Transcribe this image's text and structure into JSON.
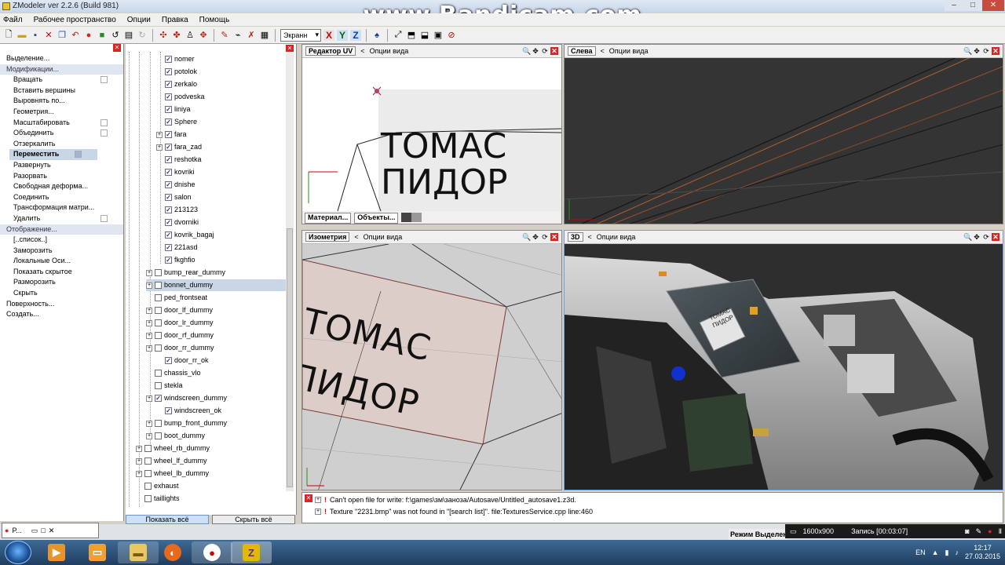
{
  "window": {
    "title": "ZModeler ver 2.2.6 (Build 981)"
  },
  "watermark": "www.Bandicam.com",
  "menu": [
    "Файл",
    "Рабочее пространство",
    "Опции",
    "Правка",
    "Помощь"
  ],
  "toolbar": {
    "view_select": "Экранн",
    "axes": [
      "X",
      "Y",
      "Z"
    ]
  },
  "left_panel": {
    "items": [
      {
        "label": "Выделение...",
        "kind": "sec"
      },
      {
        "label": "Модификации...",
        "kind": "hdr"
      },
      {
        "label": "Вращать",
        "kind": "sub"
      },
      {
        "label": "Вставить вершины",
        "kind": "sub"
      },
      {
        "label": "Выровнять по...",
        "kind": "sub"
      },
      {
        "label": "Геометрия...",
        "kind": "sub"
      },
      {
        "label": "Масштабировать",
        "kind": "sub"
      },
      {
        "label": "Объединить",
        "kind": "sub"
      },
      {
        "label": "Отзеркалить",
        "kind": "sub"
      },
      {
        "label": "Переместить",
        "kind": "sel"
      },
      {
        "label": "Развернуть",
        "kind": "sub"
      },
      {
        "label": "Разорвать",
        "kind": "sub"
      },
      {
        "label": "Свободная деформа...",
        "kind": "sub"
      },
      {
        "label": "Соединить",
        "kind": "sub"
      },
      {
        "label": "Трансформация матри...",
        "kind": "sub"
      },
      {
        "label": "Удалить",
        "kind": "sub"
      },
      {
        "label": "Отображение...",
        "kind": "hdr"
      },
      {
        "label": "[..список..]",
        "kind": "sub"
      },
      {
        "label": "Заморозить",
        "kind": "sub"
      },
      {
        "label": "Локальные Оси...",
        "kind": "sub"
      },
      {
        "label": "Показать скрытое",
        "kind": "sub"
      },
      {
        "label": "Разморозить",
        "kind": "sub"
      },
      {
        "label": "Скрыть",
        "kind": "sub"
      },
      {
        "label": "Поверхность...",
        "kind": "sec"
      },
      {
        "label": "Создать...",
        "kind": "sec"
      }
    ]
  },
  "tree": {
    "rows": [
      {
        "label": "nomer",
        "level": 3,
        "checked": true,
        "expand": false
      },
      {
        "label": "potolok",
        "level": 3,
        "checked": true,
        "expand": false
      },
      {
        "label": "zerkalo",
        "level": 3,
        "checked": true,
        "expand": false
      },
      {
        "label": "podveska",
        "level": 3,
        "checked": true,
        "expand": false
      },
      {
        "label": "liniya",
        "level": 3,
        "checked": true,
        "expand": false
      },
      {
        "label": "Sphere",
        "level": 3,
        "checked": true,
        "expand": false
      },
      {
        "label": "fara",
        "level": 3,
        "checked": true,
        "expand": true
      },
      {
        "label": "fara_zad",
        "level": 3,
        "checked": true,
        "expand": true
      },
      {
        "label": "reshotka",
        "level": 3,
        "checked": true,
        "expand": false
      },
      {
        "label": "kovriki",
        "level": 3,
        "checked": true,
        "expand": false
      },
      {
        "label": "dnishe",
        "level": 3,
        "checked": true,
        "expand": false
      },
      {
        "label": "salon",
        "level": 3,
        "checked": true,
        "expand": false
      },
      {
        "label": "213123",
        "level": 3,
        "checked": true,
        "expand": false
      },
      {
        "label": "dvorniki",
        "level": 3,
        "checked": true,
        "expand": false
      },
      {
        "label": "kovrik_bagaj",
        "level": 3,
        "checked": true,
        "expand": false
      },
      {
        "label": "221asd",
        "level": 3,
        "checked": true,
        "expand": false
      },
      {
        "label": "fkghfio",
        "level": 3,
        "checked": true,
        "expand": false
      },
      {
        "label": "bump_rear_dummy",
        "level": 2,
        "checked": false,
        "expand": true
      },
      {
        "label": "bonnet_dummy",
        "level": 2,
        "checked": false,
        "expand": true,
        "selected": true
      },
      {
        "label": "ped_frontseat",
        "level": 2,
        "checked": false,
        "expand": false
      },
      {
        "label": "door_lf_dummy",
        "level": 2,
        "checked": false,
        "expand": true
      },
      {
        "label": "door_lr_dummy",
        "level": 2,
        "checked": false,
        "expand": true
      },
      {
        "label": "door_rf_dummy",
        "level": 2,
        "checked": false,
        "expand": true
      },
      {
        "label": "door_rr_dummy",
        "level": 2,
        "checked": false,
        "expand": true
      },
      {
        "label": "door_rr_ok",
        "level": 3,
        "checked": true,
        "expand": false
      },
      {
        "label": "chassis_vlo",
        "level": 2,
        "checked": false,
        "expand": false
      },
      {
        "label": "stekla",
        "level": 2,
        "checked": false,
        "expand": false
      },
      {
        "label": "windscreen_dummy",
        "level": 2,
        "checked": true,
        "expand": true
      },
      {
        "label": "windscreen_ok",
        "level": 3,
        "checked": true,
        "expand": false
      },
      {
        "label": "bump_front_dummy",
        "level": 2,
        "checked": false,
        "expand": true
      },
      {
        "label": "boot_dummy",
        "level": 2,
        "checked": false,
        "expand": true
      },
      {
        "label": "wheel_rb_dummy",
        "level": 1,
        "checked": false,
        "expand": true
      },
      {
        "label": "wheel_lf_dummy",
        "level": 1,
        "checked": false,
        "expand": true
      },
      {
        "label": "wheel_lb_dummy",
        "level": 1,
        "checked": false,
        "expand": true
      },
      {
        "label": "exhaust",
        "level": 1,
        "checked": false,
        "expand": false
      },
      {
        "label": "taillights",
        "level": 1,
        "checked": false,
        "expand": false
      }
    ],
    "show_all": "Показать всё",
    "hide_all": "Скрыть всё"
  },
  "viewports": {
    "uv": {
      "label": "Редактор UV",
      "options": "Опции вида",
      "tab_materials": "Материал...",
      "tab_objects": "Объекты..."
    },
    "left": {
      "label": "Слева",
      "options": "Опции вида"
    },
    "iso": {
      "label": "Изометрия",
      "options": "Опции вида"
    },
    "persp": {
      "label": "3D",
      "options": "Опции вида"
    },
    "decal_line1": "ТОМАС",
    "decal_line2": "ПИДОР",
    "car_decal_line1": "ТОМАС",
    "car_decal_line2": "ПИДОР"
  },
  "console": [
    "Can't open file for write: f:\\games\\зм\\заноза/Autosave/Untitled_autosave1.z3d.",
    "Texture \"2231.bmp\" was not found in \"[search list]\". file:TexturesService.cpp line:460"
  ],
  "statusbar": {
    "mode": "Режим Выделения"
  },
  "mini_window": {
    "label": "P..."
  },
  "recorder": {
    "resolution": "1600x900",
    "record": "Запись [00:03:07]"
  },
  "taskbar": {
    "lang": "EN",
    "time": "12:17",
    "date": "27.03.2015"
  }
}
